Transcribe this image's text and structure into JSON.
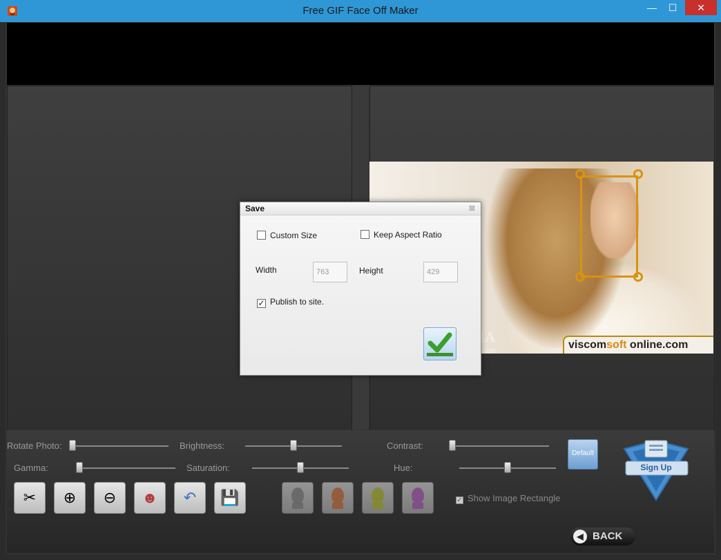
{
  "window": {
    "title": "Free GIF Face Off Maker",
    "minimize": "—",
    "maximize": "☐",
    "close": "✕"
  },
  "photo": {
    "logo_text_a": "viscom",
    "logo_text_b": "soft",
    "logo_text_c": "online.com"
  },
  "watermark": {
    "main": "SOFTPEDIA",
    "sub": "www.softpedia.com"
  },
  "controls": {
    "rotate_label": "Rotate Photo:",
    "brightness_label": "Brightness:",
    "contrast_label": "Contrast:",
    "gamma_label": "Gamma:",
    "saturation_label": "Saturation:",
    "hue_label": "Hue:",
    "default_label": "Default",
    "show_rect_label": "Show Image Rectangle",
    "back_label": "BACK",
    "signup_label": "Sign Up"
  },
  "tools": [
    {
      "name": "cut",
      "icon": "scissors-icon",
      "glyph": "✂"
    },
    {
      "name": "zoom-in",
      "icon": "zoom-in-icon",
      "glyph": "⊕"
    },
    {
      "name": "zoom-out",
      "icon": "zoom-out-icon",
      "glyph": "⊖"
    },
    {
      "name": "faces",
      "icon": "faces-icon",
      "glyph": "☻"
    },
    {
      "name": "undo",
      "icon": "undo-icon",
      "glyph": "↶"
    },
    {
      "name": "save",
      "icon": "save-icon",
      "glyph": "💾"
    }
  ],
  "filters": [
    {
      "name": "gray",
      "icon": "filter-gray-icon",
      "color": "#9a9a9a"
    },
    {
      "name": "orange",
      "icon": "filter-orange-icon",
      "color": "#e8804a"
    },
    {
      "name": "yellow",
      "icon": "filter-yellow-icon",
      "color": "#c9d23a"
    },
    {
      "name": "pink",
      "icon": "filter-pink-icon",
      "color": "#c56ad0"
    }
  ],
  "dialog": {
    "title": "Save",
    "close": "⊠",
    "custom_size_label": "Custom Size",
    "keep_aspect_label": "Keep Aspect Ratio",
    "width_label": "Width",
    "width_value": "763",
    "height_label": "Height",
    "height_value": "429",
    "publish_label": "Publish to site.",
    "publish_checked": true,
    "custom_size_checked": false,
    "keep_aspect_checked": false
  },
  "colors": {
    "titlebar": "#2f97d6",
    "accent": "#d89310",
    "close": "#c7302b"
  }
}
